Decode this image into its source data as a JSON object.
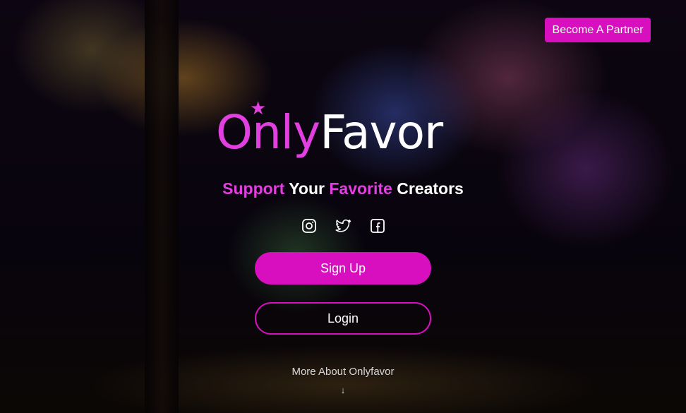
{
  "header": {
    "partner_button_label": "Become A Partner"
  },
  "logo": {
    "only": "Only",
    "favor": "Favor"
  },
  "tagline": {
    "support": "Support",
    "your": "Your",
    "favorite": "Favorite",
    "creators": "Creators"
  },
  "social": {
    "icons": [
      "instagram-icon",
      "twitter-icon",
      "facebook-icon"
    ]
  },
  "auth": {
    "signup_label": "Sign Up",
    "login_label": "Login"
  },
  "footer": {
    "more_label": "More About Onlyfavor",
    "arrow": "↓"
  },
  "colors": {
    "accent": "#d80fbe",
    "logo_pink": "#e23fe0"
  }
}
